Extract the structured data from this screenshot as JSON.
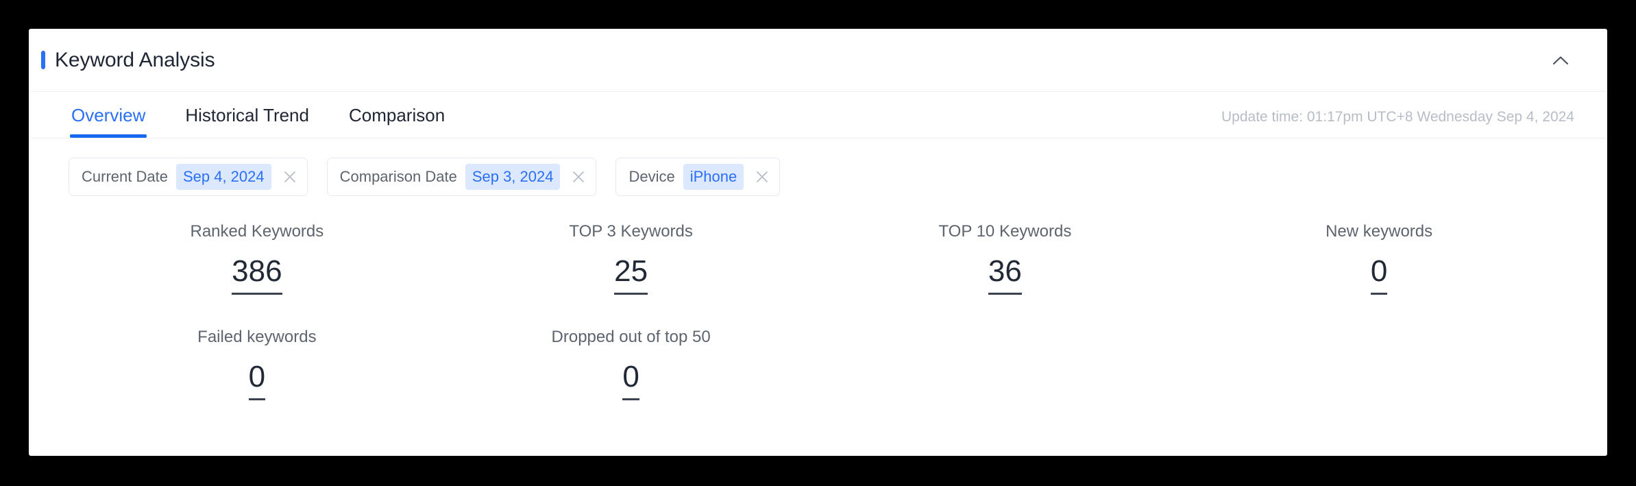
{
  "card": {
    "title": "Keyword Analysis",
    "accent_color": "#2a6ff7",
    "collapse_icon": "chevron-up-icon"
  },
  "tabs": [
    {
      "label": "Overview",
      "active": true
    },
    {
      "label": "Historical Trend",
      "active": false
    },
    {
      "label": "Comparison",
      "active": false
    }
  ],
  "update_time": "Update time: 01:17pm UTC+8 Wednesday Sep 4, 2024",
  "filters": [
    {
      "label": "Current Date",
      "value": "Sep 4, 2024",
      "close_icon": "close-icon"
    },
    {
      "label": "Comparison Date",
      "value": "Sep 3, 2024",
      "close_icon": "close-icon"
    },
    {
      "label": "Device",
      "value": "iPhone",
      "close_icon": "close-icon"
    }
  ],
  "metrics": [
    {
      "label": "Ranked Keywords",
      "value": "386"
    },
    {
      "label": "TOP 3 Keywords",
      "value": "25"
    },
    {
      "label": "TOP 10 Keywords",
      "value": "36"
    },
    {
      "label": "New keywords",
      "value": "0"
    },
    {
      "label": "Failed keywords",
      "value": "0"
    },
    {
      "label": "Dropped out of top 50",
      "value": "0"
    }
  ]
}
